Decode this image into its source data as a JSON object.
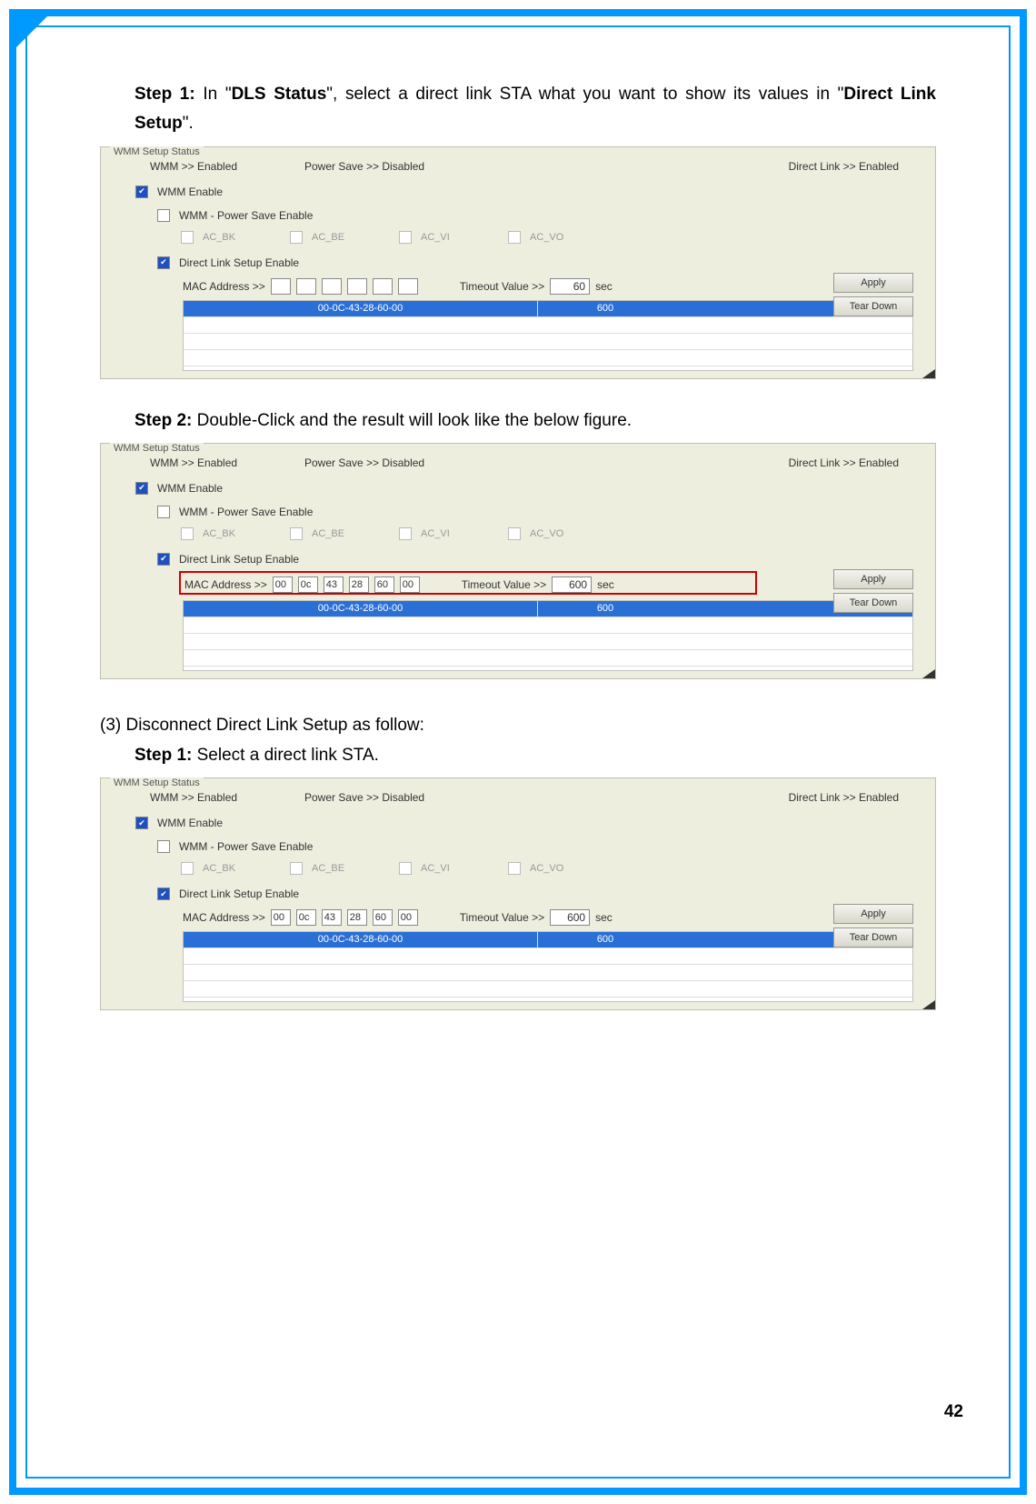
{
  "step1": {
    "label": "Step 1:",
    "text_a": " In \"",
    "bold_a": "DLS Status",
    "text_b": "\", select a direct link STA what you want to show its values in \"",
    "bold_b": "Direct Link Setup",
    "text_c": "\"."
  },
  "step2": {
    "label": "Step 2:",
    "text": " Double-Click and the result will look like the below figure."
  },
  "section3": "(3)  Disconnect Direct Link Setup as follow:",
  "step3_1": {
    "label": "Step 1:",
    "text": " Select a direct link STA."
  },
  "panel_common": {
    "fieldset": "WMM Setup Status",
    "wmm_status": "WMM >> Enabled",
    "powersave_status": "Power Save >> Disabled",
    "directlink_status": "Direct Link >> Enabled",
    "wmm_enable": "WMM Enable",
    "power_save_enable": "WMM - Power Save Enable",
    "ac_bk": "AC_BK",
    "ac_be": "AC_BE",
    "ac_vi": "AC_VI",
    "ac_vo": "AC_VO",
    "dls_enable": "Direct Link Setup Enable",
    "mac_label": "MAC Address >>",
    "timeout_label": "Timeout Value >>",
    "sec": "sec",
    "apply": "Apply",
    "teardown": "Tear Down",
    "grid_mac": "00-0C-43-28-60-00",
    "grid_timeout": "600"
  },
  "panel1": {
    "mac": [
      "",
      "",
      "",
      "",
      "",
      ""
    ],
    "timeout": "60"
  },
  "panel2": {
    "mac": [
      "00",
      "0c",
      "43",
      "28",
      "60",
      "00"
    ],
    "timeout": "600"
  },
  "panel3": {
    "mac": [
      "00",
      "0c",
      "43",
      "28",
      "60",
      "00"
    ],
    "timeout": "600"
  },
  "page_number": "42"
}
